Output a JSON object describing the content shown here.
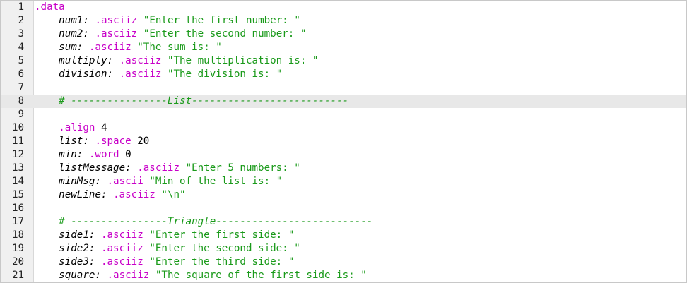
{
  "editor": {
    "current_line": 8,
    "lines": [
      {
        "n": "1",
        "indent": "",
        "tokens": [
          {
            "t": "dir",
            "v": ".data"
          }
        ]
      },
      {
        "n": "2",
        "indent": "    ",
        "tokens": [
          {
            "t": "lbl",
            "v": "num1:"
          },
          {
            "t": "plain",
            "v": " "
          },
          {
            "t": "dir",
            "v": ".asciiz"
          },
          {
            "t": "plain",
            "v": " "
          },
          {
            "t": "str",
            "v": "\"Enter the first number: \""
          }
        ]
      },
      {
        "n": "3",
        "indent": "    ",
        "tokens": [
          {
            "t": "lbl",
            "v": "num2:"
          },
          {
            "t": "plain",
            "v": " "
          },
          {
            "t": "dir",
            "v": ".asciiz"
          },
          {
            "t": "plain",
            "v": " "
          },
          {
            "t": "str",
            "v": "\"Enter the second number: \""
          }
        ]
      },
      {
        "n": "4",
        "indent": "    ",
        "tokens": [
          {
            "t": "lbl",
            "v": "sum:"
          },
          {
            "t": "plain",
            "v": " "
          },
          {
            "t": "dir",
            "v": ".asciiz"
          },
          {
            "t": "plain",
            "v": " "
          },
          {
            "t": "str",
            "v": "\"The sum is: \""
          }
        ]
      },
      {
        "n": "5",
        "indent": "    ",
        "tokens": [
          {
            "t": "lbl",
            "v": "multiply:"
          },
          {
            "t": "plain",
            "v": " "
          },
          {
            "t": "dir",
            "v": ".asciiz"
          },
          {
            "t": "plain",
            "v": " "
          },
          {
            "t": "str",
            "v": "\"The multiplication is: \""
          }
        ]
      },
      {
        "n": "6",
        "indent": "    ",
        "tokens": [
          {
            "t": "lbl",
            "v": "division:"
          },
          {
            "t": "plain",
            "v": " "
          },
          {
            "t": "dir",
            "v": ".asciiz"
          },
          {
            "t": "plain",
            "v": " "
          },
          {
            "t": "str",
            "v": "\"The division is: \""
          }
        ]
      },
      {
        "n": "7",
        "indent": "",
        "tokens": []
      },
      {
        "n": "8",
        "indent": "    ",
        "tokens": [
          {
            "t": "cmt",
            "v": "# ----------------List--------------------------"
          }
        ]
      },
      {
        "n": "9",
        "indent": "",
        "tokens": []
      },
      {
        "n": "10",
        "indent": "    ",
        "tokens": [
          {
            "t": "dir",
            "v": ".align"
          },
          {
            "t": "plain",
            "v": " "
          },
          {
            "t": "num",
            "v": "4"
          }
        ]
      },
      {
        "n": "11",
        "indent": "    ",
        "tokens": [
          {
            "t": "lbl",
            "v": "list:"
          },
          {
            "t": "plain",
            "v": " "
          },
          {
            "t": "dir",
            "v": ".space"
          },
          {
            "t": "plain",
            "v": " "
          },
          {
            "t": "num",
            "v": "20"
          }
        ]
      },
      {
        "n": "12",
        "indent": "    ",
        "tokens": [
          {
            "t": "lbl",
            "v": "min:"
          },
          {
            "t": "plain",
            "v": " "
          },
          {
            "t": "dir",
            "v": ".word"
          },
          {
            "t": "plain",
            "v": " "
          },
          {
            "t": "num",
            "v": "0"
          }
        ]
      },
      {
        "n": "13",
        "indent": "    ",
        "tokens": [
          {
            "t": "lbl",
            "v": "listMessage:"
          },
          {
            "t": "plain",
            "v": " "
          },
          {
            "t": "dir",
            "v": ".asciiz"
          },
          {
            "t": "plain",
            "v": " "
          },
          {
            "t": "str",
            "v": "\"Enter 5 numbers: \""
          }
        ]
      },
      {
        "n": "14",
        "indent": "    ",
        "tokens": [
          {
            "t": "lbl",
            "v": "minMsg:"
          },
          {
            "t": "plain",
            "v": " "
          },
          {
            "t": "dir",
            "v": ".ascii"
          },
          {
            "t": "plain",
            "v": " "
          },
          {
            "t": "str",
            "v": "\"Min of the list is: \""
          }
        ]
      },
      {
        "n": "15",
        "indent": "    ",
        "tokens": [
          {
            "t": "lbl",
            "v": "newLine:"
          },
          {
            "t": "plain",
            "v": " "
          },
          {
            "t": "dir",
            "v": ".asciiz"
          },
          {
            "t": "plain",
            "v": " "
          },
          {
            "t": "str",
            "v": "\"\\n\""
          }
        ]
      },
      {
        "n": "16",
        "indent": "",
        "tokens": []
      },
      {
        "n": "17",
        "indent": "    ",
        "tokens": [
          {
            "t": "cmt",
            "v": "# ----------------Triangle--------------------------"
          }
        ]
      },
      {
        "n": "18",
        "indent": "    ",
        "tokens": [
          {
            "t": "lbl",
            "v": "side1:"
          },
          {
            "t": "plain",
            "v": " "
          },
          {
            "t": "dir",
            "v": ".asciiz"
          },
          {
            "t": "plain",
            "v": " "
          },
          {
            "t": "str",
            "v": "\"Enter the first side: \""
          }
        ]
      },
      {
        "n": "19",
        "indent": "    ",
        "tokens": [
          {
            "t": "lbl",
            "v": "side2:"
          },
          {
            "t": "plain",
            "v": " "
          },
          {
            "t": "dir",
            "v": ".asciiz"
          },
          {
            "t": "plain",
            "v": " "
          },
          {
            "t": "str",
            "v": "\"Enter the second side: \""
          }
        ]
      },
      {
        "n": "20",
        "indent": "    ",
        "tokens": [
          {
            "t": "lbl",
            "v": "side3:"
          },
          {
            "t": "plain",
            "v": " "
          },
          {
            "t": "dir",
            "v": ".asciiz"
          },
          {
            "t": "plain",
            "v": " "
          },
          {
            "t": "str",
            "v": "\"Enter the third side: \""
          }
        ]
      },
      {
        "n": "21",
        "indent": "    ",
        "tokens": [
          {
            "t": "lbl",
            "v": "square:"
          },
          {
            "t": "plain",
            "v": " "
          },
          {
            "t": "dir",
            "v": ".asciiz"
          },
          {
            "t": "plain",
            "v": " "
          },
          {
            "t": "str",
            "v": "\"The square of the first side is: \""
          }
        ]
      }
    ]
  },
  "colors": {
    "directive": "#c800c8",
    "string": "#1a9a1a",
    "comment": "#1a9a1a",
    "current_line_bg": "#e8e8e8",
    "gutter_bg": "#f0f0f0"
  }
}
